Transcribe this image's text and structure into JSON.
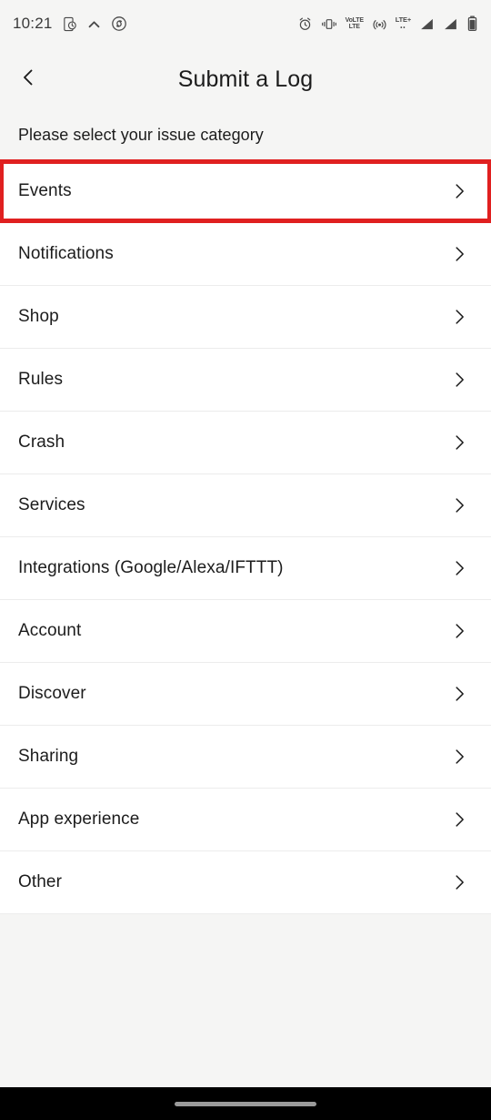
{
  "status_bar": {
    "time": "10:21",
    "left_icons": [
      "phone-clock-icon",
      "chevron-up-icon",
      "shazam-icon"
    ],
    "right_icons": [
      "alarm-clock-icon",
      "vibrate-icon",
      "volte-icon",
      "hotspot-icon",
      "lte-plus-icon",
      "signal-bars-icon",
      "signal-bars-2-icon",
      "battery-icon"
    ],
    "volte_line1": "VoLTE",
    "volte_line2": "LTE",
    "lte_label": "LTE",
    "lte_plus": "+",
    "lte_dots": "••"
  },
  "header": {
    "back_icon": "chevron-left-icon",
    "title": "Submit a Log"
  },
  "subtitle": "Please select your issue category",
  "list": {
    "chevron_icon": "chevron-right-icon",
    "items": [
      {
        "label": "Events",
        "highlighted": true
      },
      {
        "label": "Notifications",
        "highlighted": false
      },
      {
        "label": "Shop",
        "highlighted": false
      },
      {
        "label": "Rules",
        "highlighted": false
      },
      {
        "label": "Crash",
        "highlighted": false
      },
      {
        "label": "Services",
        "highlighted": false
      },
      {
        "label": "Integrations (Google/Alexa/IFTTT)",
        "highlighted": false
      },
      {
        "label": "Account",
        "highlighted": false
      },
      {
        "label": "Discover",
        "highlighted": false
      },
      {
        "label": "Sharing",
        "highlighted": false
      },
      {
        "label": "App experience",
        "highlighted": false
      },
      {
        "label": "Other",
        "highlighted": false
      }
    ]
  },
  "nav_bar": {
    "gesture_pill": "home-gesture-pill"
  },
  "colors": {
    "highlight_border": "#e02020",
    "page_background": "#f5f5f4",
    "row_background": "#ffffff",
    "separator": "#ececec",
    "text_primary": "#1c1c1c",
    "nav_background": "#000000"
  }
}
